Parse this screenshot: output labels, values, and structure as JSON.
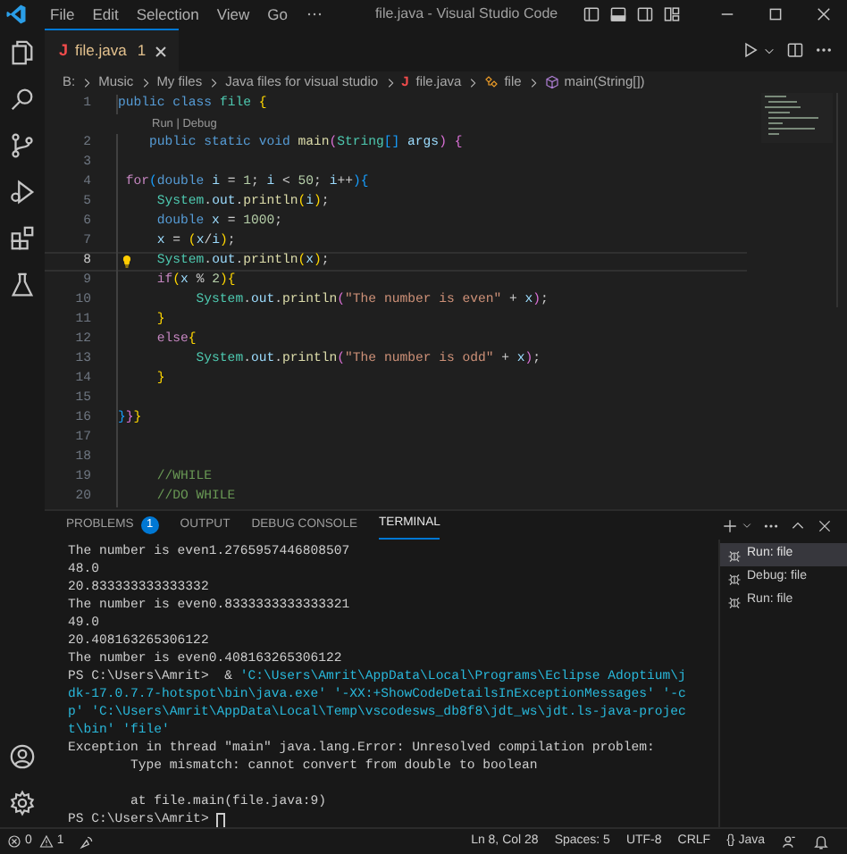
{
  "title_bar": {
    "menu": [
      "File",
      "Edit",
      "Selection",
      "View",
      "Go"
    ],
    "title": "file.java - Visual Studio Code"
  },
  "tab": {
    "file_icon": "J",
    "label": "file.java",
    "problems": "1",
    "selected": true
  },
  "breadcrumb": {
    "items": [
      {
        "kind": "folder",
        "text": "B:"
      },
      {
        "kind": "folder",
        "text": "Music"
      },
      {
        "kind": "folder",
        "text": "My files"
      },
      {
        "kind": "folder",
        "text": "Java files for visual studio"
      },
      {
        "kind": "file",
        "text": "file.java",
        "file_icon": "J"
      },
      {
        "kind": "class",
        "text": "file"
      },
      {
        "kind": "method",
        "text": "main(String[])"
      }
    ]
  },
  "editor": {
    "lines": [
      {
        "kind": "code",
        "n": "1",
        "current": false,
        "code": [
          {
            "kind": "kw",
            "text": "public class "
          },
          {
            "kind": "cls",
            "text": "file "
          },
          {
            "kind": "b1",
            "text": "{"
          }
        ]
      },
      {
        "kind": "codelens",
        "text": "Run | Debug"
      },
      {
        "kind": "code",
        "n": "2",
        "current": false,
        "code": [
          {
            "kind": "kw",
            "text": "    public static void "
          },
          {
            "kind": "fn",
            "text": "main"
          },
          {
            "kind": "b2",
            "text": "("
          },
          {
            "kind": "cls",
            "text": "String"
          },
          {
            "kind": "b3",
            "text": "[] "
          },
          {
            "kind": "var",
            "text": "args"
          },
          {
            "kind": "b2",
            "text": ") {"
          }
        ]
      },
      {
        "kind": "code",
        "n": "3",
        "current": false
      },
      {
        "kind": "code",
        "n": "4",
        "current": false,
        "code": [
          {
            "kind": "ctl",
            "text": " for"
          },
          {
            "kind": "b3",
            "text": "("
          },
          {
            "kind": "kw",
            "text": "double "
          },
          {
            "kind": "var",
            "text": "i"
          },
          {
            "kind": "p",
            "text": " = "
          },
          {
            "kind": "num",
            "text": "1"
          },
          {
            "kind": "p",
            "text": "; "
          },
          {
            "kind": "var",
            "text": "i"
          },
          {
            "kind": "p",
            "text": " < "
          },
          {
            "kind": "num",
            "text": "50"
          },
          {
            "kind": "p",
            "text": "; "
          },
          {
            "kind": "var",
            "text": "i"
          },
          {
            "kind": "p",
            "text": "++"
          },
          {
            "kind": "b3",
            "text": "){"
          }
        ]
      },
      {
        "kind": "code",
        "n": "5",
        "current": false,
        "code": [
          {
            "kind": "cls",
            "text": "     System"
          },
          {
            "kind": "p",
            "text": "."
          },
          {
            "kind": "var",
            "text": "out"
          },
          {
            "kind": "p",
            "text": "."
          },
          {
            "kind": "fn",
            "text": "println"
          },
          {
            "kind": "b1",
            "text": "("
          },
          {
            "kind": "var",
            "text": "i"
          },
          {
            "kind": "b1",
            "text": ")"
          },
          {
            "kind": "p",
            "text": ";"
          }
        ]
      },
      {
        "kind": "code",
        "n": "6",
        "current": false,
        "code": [
          {
            "kind": "kw",
            "text": "     double "
          },
          {
            "kind": "var",
            "text": "x"
          },
          {
            "kind": "p",
            "text": " = "
          },
          {
            "kind": "num",
            "text": "1000"
          },
          {
            "kind": "p",
            "text": ";"
          }
        ]
      },
      {
        "kind": "code",
        "n": "7",
        "current": false,
        "code": [
          {
            "kind": "var",
            "text": "     x"
          },
          {
            "kind": "p",
            "text": " = "
          },
          {
            "kind": "b1",
            "text": "("
          },
          {
            "kind": "var",
            "text": "x"
          },
          {
            "kind": "p",
            "text": "/"
          },
          {
            "kind": "var",
            "text": "i"
          },
          {
            "kind": "b1",
            "text": ")"
          },
          {
            "kind": "p",
            "text": ";"
          }
        ]
      },
      {
        "kind": "code",
        "n": "8",
        "current": true,
        "code": [
          {
            "kind": "cls",
            "text": "     System"
          },
          {
            "kind": "p",
            "text": "."
          },
          {
            "kind": "var",
            "text": "out"
          },
          {
            "kind": "p",
            "text": "."
          },
          {
            "kind": "fn",
            "text": "println"
          },
          {
            "kind": "b1",
            "text": "("
          },
          {
            "kind": "var",
            "text": "x"
          },
          {
            "kind": "b1",
            "text": ")"
          },
          {
            "kind": "p",
            "text": ";"
          }
        ]
      },
      {
        "kind": "code",
        "n": "9",
        "current": false,
        "code": [
          {
            "kind": "ctl",
            "text": "     if"
          },
          {
            "kind": "b1",
            "text": "("
          },
          {
            "kind": "var",
            "text": "x"
          },
          {
            "kind": "p",
            "text": " % "
          },
          {
            "kind": "num",
            "text": "2"
          },
          {
            "kind": "b1",
            "text": "){"
          }
        ]
      },
      {
        "kind": "code",
        "n": "10",
        "current": false,
        "code": [
          {
            "kind": "cls",
            "text": "          System"
          },
          {
            "kind": "p",
            "text": "."
          },
          {
            "kind": "var",
            "text": "out"
          },
          {
            "kind": "p",
            "text": "."
          },
          {
            "kind": "fn",
            "text": "println"
          },
          {
            "kind": "b2",
            "text": "("
          },
          {
            "kind": "str",
            "text": "\"The number is even\""
          },
          {
            "kind": "p",
            "text": " + "
          },
          {
            "kind": "var",
            "text": "x"
          },
          {
            "kind": "b2",
            "text": ")"
          },
          {
            "kind": "p",
            "text": ";"
          }
        ]
      },
      {
        "kind": "code",
        "n": "11",
        "current": false,
        "code": [
          {
            "kind": "b1",
            "text": "     }"
          }
        ]
      },
      {
        "kind": "code",
        "n": "12",
        "current": false,
        "code": [
          {
            "kind": "ctl",
            "text": "     else"
          },
          {
            "kind": "b1",
            "text": "{"
          }
        ]
      },
      {
        "kind": "code",
        "n": "13",
        "current": false,
        "code": [
          {
            "kind": "cls",
            "text": "          System"
          },
          {
            "kind": "p",
            "text": "."
          },
          {
            "kind": "var",
            "text": "out"
          },
          {
            "kind": "p",
            "text": "."
          },
          {
            "kind": "fn",
            "text": "println"
          },
          {
            "kind": "b2",
            "text": "("
          },
          {
            "kind": "str",
            "text": "\"The number is odd\""
          },
          {
            "kind": "p",
            "text": " + "
          },
          {
            "kind": "var",
            "text": "x"
          },
          {
            "kind": "b2",
            "text": ")"
          },
          {
            "kind": "p",
            "text": ";"
          }
        ]
      },
      {
        "kind": "code",
        "n": "14",
        "current": false,
        "code": [
          {
            "kind": "b1",
            "text": "     }"
          }
        ]
      },
      {
        "kind": "code",
        "n": "15",
        "current": false
      },
      {
        "kind": "code",
        "n": "16",
        "current": false,
        "code": [
          {
            "kind": "b3",
            "text": "}"
          },
          {
            "kind": "b2",
            "text": "}"
          },
          {
            "kind": "b1",
            "text": "}"
          }
        ]
      },
      {
        "kind": "code",
        "n": "17",
        "current": false
      },
      {
        "kind": "code",
        "n": "18",
        "current": false
      },
      {
        "kind": "code",
        "n": "19",
        "current": false,
        "code": [
          {
            "kind": "cmt",
            "text": "     //WHILE"
          }
        ]
      },
      {
        "kind": "code",
        "n": "20",
        "current": false,
        "code": [
          {
            "kind": "cmt",
            "text": "     //DO WHILE"
          }
        ]
      }
    ]
  },
  "panel": {
    "tabs": [
      {
        "label": "PROBLEMS",
        "badge": "1",
        "selected": false
      },
      {
        "label": "OUTPUT",
        "selected": false
      },
      {
        "label": "DEBUG CONSOLE",
        "selected": false
      },
      {
        "label": "TERMINAL",
        "selected": true
      }
    ],
    "terminal": [
      {
        "kind": "text",
        "segs": [
          {
            "kind": "p",
            "text": "The number is even1.2765957446808507"
          }
        ]
      },
      {
        "kind": "text",
        "segs": [
          {
            "kind": "p",
            "text": "48.0"
          }
        ]
      },
      {
        "kind": "text",
        "segs": [
          {
            "kind": "p",
            "text": "20.833333333333332"
          }
        ]
      },
      {
        "kind": "text",
        "segs": [
          {
            "kind": "p",
            "text": "The number is even0.8333333333333321"
          }
        ]
      },
      {
        "kind": "text",
        "segs": [
          {
            "kind": "p",
            "text": "49.0"
          }
        ]
      },
      {
        "kind": "text",
        "segs": [
          {
            "kind": "p",
            "text": "20.408163265306122"
          }
        ]
      },
      {
        "kind": "text",
        "segs": [
          {
            "kind": "p",
            "text": "The number is even0.408163265306122"
          }
        ]
      },
      {
        "kind": "text",
        "segs": [
          {
            "kind": "p",
            "text": "PS C:\\Users\\Amrit>  & "
          },
          {
            "kind": "path",
            "text": "'C:\\Users\\Amrit\\AppData\\Local\\Programs\\Eclipse Adoptium\\j"
          }
        ]
      },
      {
        "kind": "text",
        "segs": [
          {
            "kind": "path",
            "text": "dk-17.0.7.7-hotspot\\bin\\java.exe' '-XX:+ShowCodeDetailsInExceptionMessages' '-c"
          }
        ]
      },
      {
        "kind": "text",
        "segs": [
          {
            "kind": "path",
            "text": "p' 'C:\\Users\\Amrit\\AppData\\Local\\Temp\\vscodesws_db8f8\\jdt_ws\\jdt.ls-java-projec"
          }
        ]
      },
      {
        "kind": "text",
        "segs": [
          {
            "kind": "path",
            "text": "t\\bin' 'file'"
          }
        ]
      },
      {
        "kind": "text",
        "segs": [
          {
            "kind": "p",
            "text": "Exception in thread \"main\" java.lang.Error: Unresolved compilation problem:"
          }
        ]
      },
      {
        "kind": "text",
        "segs": [
          {
            "kind": "p",
            "text": "        Type mismatch: cannot convert from double to boolean"
          }
        ]
      },
      {
        "kind": "blank"
      },
      {
        "kind": "text",
        "segs": [
          {
            "kind": "p",
            "text": "        at file.main(file.java:9)"
          }
        ]
      },
      {
        "kind": "prompt",
        "segs": [
          {
            "kind": "p",
            "text": "PS C:\\Users\\Amrit>"
          }
        ]
      }
    ],
    "sessions": [
      {
        "label": "Run: file",
        "selected": true
      },
      {
        "label": "Debug: file",
        "selected": false
      },
      {
        "label": "Run: file",
        "selected": false
      }
    ]
  },
  "status_bar": {
    "errors": "0",
    "warnings": "1",
    "right": [
      "Ln 8, Col 28",
      "Spaces: 5",
      "UTF-8",
      "CRLF"
    ],
    "language": "{} Java"
  }
}
